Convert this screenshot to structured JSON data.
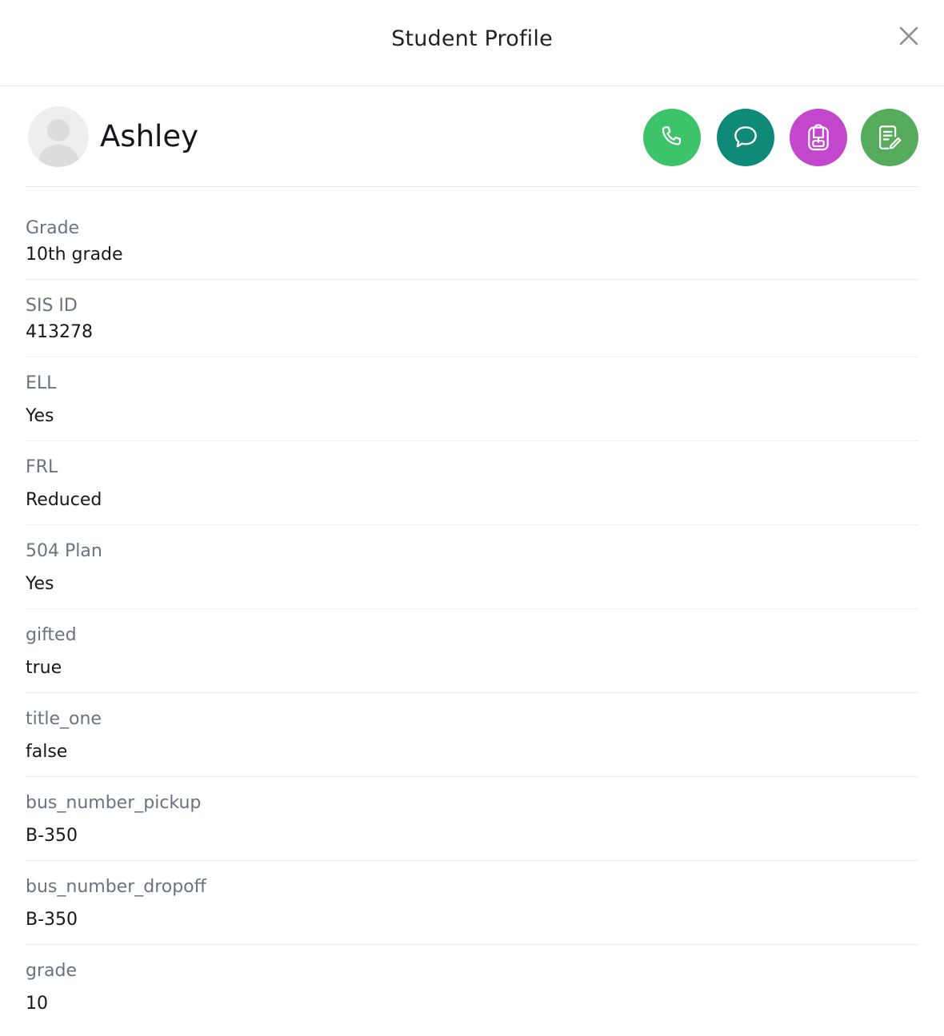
{
  "header": {
    "title": "Student Profile",
    "close_icon": "close-icon"
  },
  "student": {
    "name": "Ashley",
    "avatar_icon": "person-silhouette-icon"
  },
  "actions": [
    {
      "name": "call",
      "icon": "phone-icon",
      "color": "#3dc46a"
    },
    {
      "name": "message",
      "icon": "chat-bubble-icon",
      "color": "#0f8a78"
    },
    {
      "name": "backpack",
      "icon": "backpack-icon",
      "color": "#c247cc"
    },
    {
      "name": "notes",
      "icon": "note-edit-icon",
      "color": "#55ab5b"
    }
  ],
  "fields": [
    {
      "label": "Grade",
      "value": "10th grade"
    },
    {
      "label": "SIS ID",
      "value": "413278"
    },
    {
      "label": "ELL",
      "value": "Yes"
    },
    {
      "label": "FRL",
      "value": "Reduced"
    },
    {
      "label": "504 Plan",
      "value": "Yes"
    },
    {
      "label": "gifted",
      "value": "true"
    },
    {
      "label": "title_one",
      "value": "false"
    },
    {
      "label": "bus_number_pickup",
      "value": "B-350"
    },
    {
      "label": "bus_number_dropoff",
      "value": "B-350"
    },
    {
      "label": "grade",
      "value": "10"
    }
  ]
}
